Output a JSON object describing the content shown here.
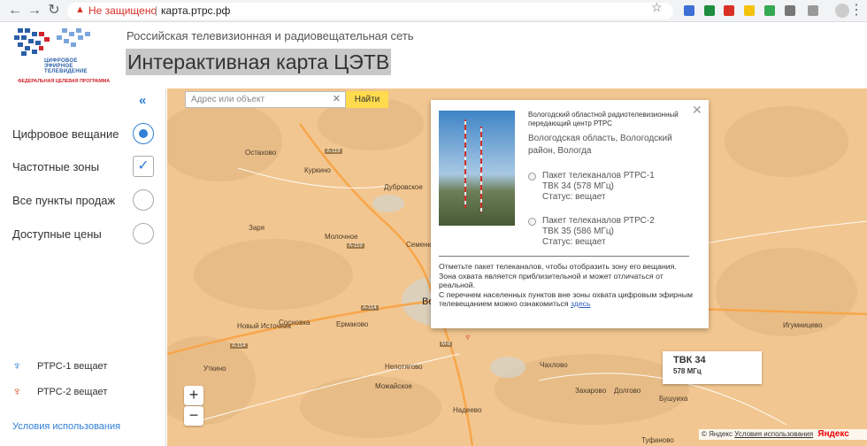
{
  "browser": {
    "security_label": "Не защищено",
    "url": "карта.ртрс.рф"
  },
  "header": {
    "logo_lines": [
      "ЦИФРОВОЕ",
      "ЭФИРНОЕ",
      "ТЕЛЕВИДЕНИЕ"
    ],
    "logo_program": "ФЕДЕРАЛЬНАЯ ЦЕЛЕВАЯ ПРОГРАММА",
    "subtitle": "Российская телевизионная и радиовещательная сеть",
    "title": "Интерактивная карта ЦЭТВ"
  },
  "sidebar": {
    "collapse_label": "«",
    "options": [
      {
        "label": "Цифровое вещание",
        "state": "radio-selected"
      },
      {
        "label": "Частотные зоны",
        "state": "checked"
      },
      {
        "label": "Все пункты продаж",
        "state": "unselected"
      },
      {
        "label": "Доступные цены",
        "state": "unselected"
      }
    ],
    "legend": [
      {
        "label": "РТРС-1 вещает",
        "color": "#2f7fd6"
      },
      {
        "label": "РТРС-2 вещает",
        "color": "#d9502a"
      }
    ],
    "terms_link": "Условия использования"
  },
  "map": {
    "search_placeholder": "Адрес или объект",
    "search_button": "Найти",
    "zoom_in": "+",
    "zoom_out": "−",
    "places": [
      "Остахово",
      "Куркино",
      "Дубровское",
      "Заря",
      "Молочное",
      "Семенково",
      "Вологда",
      "Новый Источник",
      "Сосновка",
      "Ермаково",
      "Уткино",
      "Непотягово",
      "Можайское",
      "Чахлово",
      "Захарово",
      "Долгово",
      "Надеево",
      "Бушуиха",
      "Игумницево",
      "Туфаново"
    ],
    "roads": [
      "А-119",
      "А-119",
      "А-114",
      "А-114",
      "М-8"
    ],
    "popup": {
      "title": "Вологодский областной радиотелевизионный передающий центр РТРС",
      "address": "Вологодская область, Вологодский район, Вологда",
      "packages": [
        {
          "name": "Пакет телеканалов РТРС-1",
          "channel": "ТВК 34 (578 МГц)",
          "status": "Статус: вещает"
        },
        {
          "name": "Пакет телеканалов РТРС-2",
          "channel": "ТВК 35 (586 МГц)",
          "status": "Статус: вещает"
        }
      ],
      "note_1": "Отметьте пакет телеканалов, чтобы отобразить зону его вещания.",
      "note_2": "Зона охвата является приблизительной и может отличаться от реальной.",
      "note_3": "С перечнем населенных пунктов вне зоны охвата цифровым эфирным телевещанием можно ознакомиться",
      "note_link": "здесь"
    },
    "channel_label": {
      "title": "ТВК 34",
      "freq": "578 МГц"
    },
    "copyright": "© Яндекс",
    "copyright_terms": "Условия использования",
    "yandex_logo": "Яндекс"
  }
}
